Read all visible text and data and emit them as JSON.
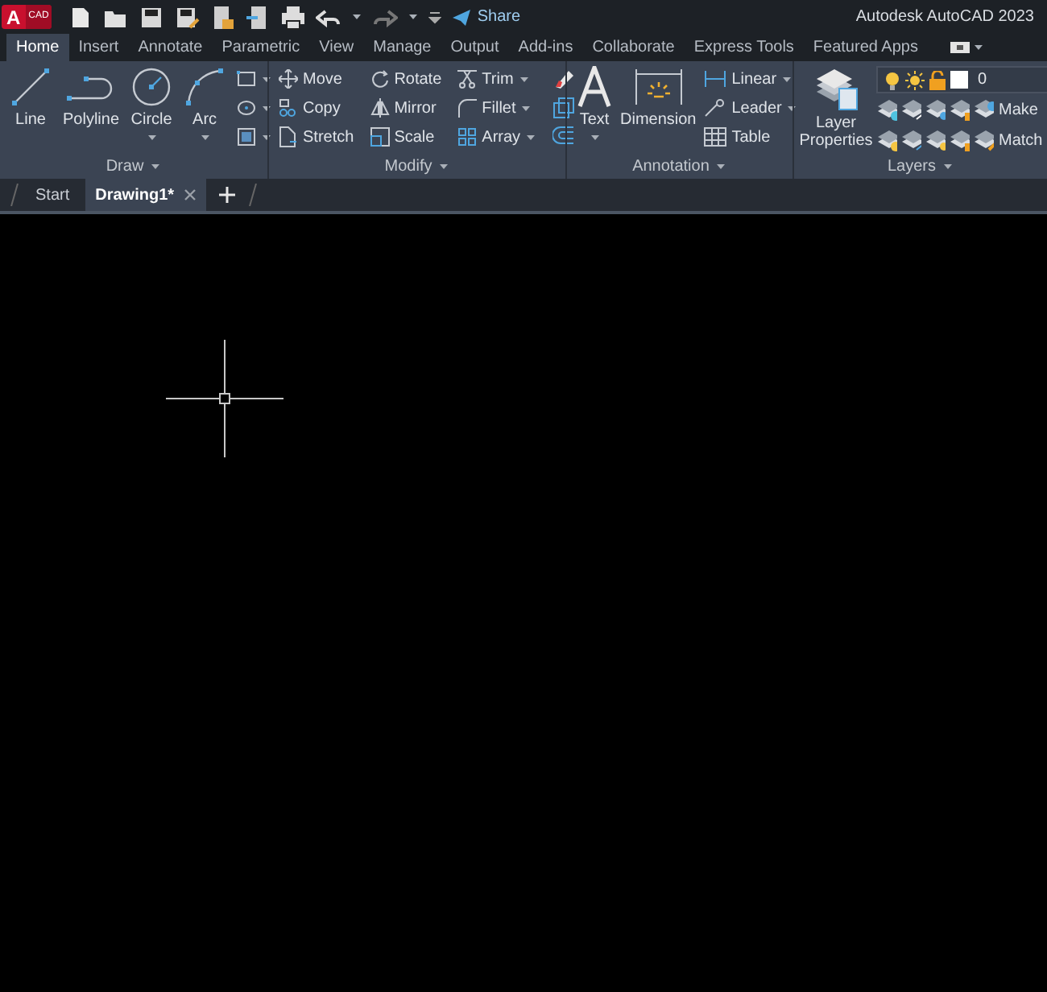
{
  "app_badge": {
    "letter": "A",
    "text": "CAD"
  },
  "quick_access": {
    "share": "Share"
  },
  "title": "Autodesk AutoCAD 2023",
  "ribbon_tabs": [
    {
      "label": "Home",
      "selected": true
    },
    {
      "label": "Insert",
      "selected": false
    },
    {
      "label": "Annotate",
      "selected": false
    },
    {
      "label": "Parametric",
      "selected": false
    },
    {
      "label": "View",
      "selected": false
    },
    {
      "label": "Manage",
      "selected": false
    },
    {
      "label": "Output",
      "selected": false
    },
    {
      "label": "Add-ins",
      "selected": false
    },
    {
      "label": "Collaborate",
      "selected": false
    },
    {
      "label": "Express Tools",
      "selected": false
    },
    {
      "label": "Featured Apps",
      "selected": false
    }
  ],
  "draw_panel": {
    "title": "Draw",
    "large_tools": [
      {
        "label": "Line",
        "dropdown": false
      },
      {
        "label": "Polyline",
        "dropdown": false
      },
      {
        "label": "Circle",
        "dropdown": true
      },
      {
        "label": "Arc",
        "dropdown": true
      }
    ]
  },
  "modify_panel": {
    "title": "Modify",
    "tools": [
      {
        "label": "Move",
        "dropdown": false
      },
      {
        "label": "Copy",
        "dropdown": false
      },
      {
        "label": "Stretch",
        "dropdown": false
      },
      {
        "label": "Rotate",
        "dropdown": false
      },
      {
        "label": "Mirror",
        "dropdown": false
      },
      {
        "label": "Scale",
        "dropdown": false
      },
      {
        "label": "Trim",
        "dropdown": true
      },
      {
        "label": "Fillet",
        "dropdown": true
      },
      {
        "label": "Array",
        "dropdown": true
      }
    ]
  },
  "annotation_panel": {
    "title": "Annotation",
    "large_tools": [
      {
        "label": "Text",
        "dropdown": true
      },
      {
        "label": "Dimension",
        "dropdown": false
      }
    ],
    "tools": [
      {
        "label": "Linear",
        "dropdown": true
      },
      {
        "label": "Leader",
        "dropdown": true
      },
      {
        "label": "Table",
        "dropdown": false
      }
    ]
  },
  "layers_panel": {
    "title": "Layers",
    "large_tool": {
      "label": "Layer Properties"
    },
    "current_layer": "0",
    "tools": [
      {
        "label": "Make"
      },
      {
        "label": "Match"
      }
    ]
  },
  "doc_tabs": [
    {
      "label": "Start",
      "selected": false,
      "closable": false
    },
    {
      "label": "Drawing1*",
      "selected": true,
      "closable": true
    }
  ]
}
